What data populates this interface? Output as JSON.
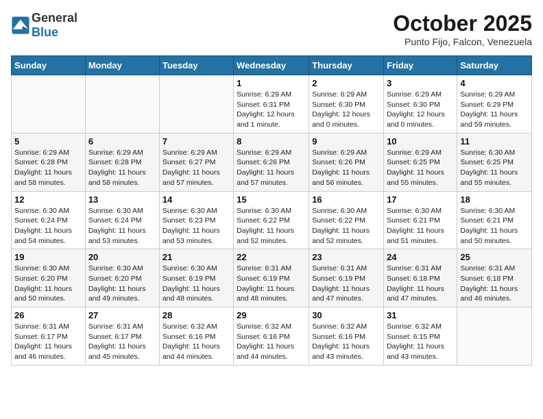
{
  "header": {
    "logo_general": "General",
    "logo_blue": "Blue",
    "month_title": "October 2025",
    "location": "Punto Fijo, Falcon, Venezuela"
  },
  "weekdays": [
    "Sunday",
    "Monday",
    "Tuesday",
    "Wednesday",
    "Thursday",
    "Friday",
    "Saturday"
  ],
  "weeks": [
    [
      {
        "day": "",
        "info": ""
      },
      {
        "day": "",
        "info": ""
      },
      {
        "day": "",
        "info": ""
      },
      {
        "day": "1",
        "info": "Sunrise: 6:29 AM\nSunset: 6:31 PM\nDaylight: 12 hours\nand 1 minute."
      },
      {
        "day": "2",
        "info": "Sunrise: 6:29 AM\nSunset: 6:30 PM\nDaylight: 12 hours\nand 0 minutes."
      },
      {
        "day": "3",
        "info": "Sunrise: 6:29 AM\nSunset: 6:30 PM\nDaylight: 12 hours\nand 0 minutes."
      },
      {
        "day": "4",
        "info": "Sunrise: 6:29 AM\nSunset: 6:29 PM\nDaylight: 11 hours\nand 59 minutes."
      }
    ],
    [
      {
        "day": "5",
        "info": "Sunrise: 6:29 AM\nSunset: 6:28 PM\nDaylight: 11 hours\nand 58 minutes."
      },
      {
        "day": "6",
        "info": "Sunrise: 6:29 AM\nSunset: 6:28 PM\nDaylight: 11 hours\nand 58 minutes."
      },
      {
        "day": "7",
        "info": "Sunrise: 6:29 AM\nSunset: 6:27 PM\nDaylight: 11 hours\nand 57 minutes."
      },
      {
        "day": "8",
        "info": "Sunrise: 6:29 AM\nSunset: 6:26 PM\nDaylight: 11 hours\nand 57 minutes."
      },
      {
        "day": "9",
        "info": "Sunrise: 6:29 AM\nSunset: 6:26 PM\nDaylight: 11 hours\nand 56 minutes."
      },
      {
        "day": "10",
        "info": "Sunrise: 6:29 AM\nSunset: 6:25 PM\nDaylight: 11 hours\nand 55 minutes."
      },
      {
        "day": "11",
        "info": "Sunrise: 6:30 AM\nSunset: 6:25 PM\nDaylight: 11 hours\nand 55 minutes."
      }
    ],
    [
      {
        "day": "12",
        "info": "Sunrise: 6:30 AM\nSunset: 6:24 PM\nDaylight: 11 hours\nand 54 minutes."
      },
      {
        "day": "13",
        "info": "Sunrise: 6:30 AM\nSunset: 6:24 PM\nDaylight: 11 hours\nand 53 minutes."
      },
      {
        "day": "14",
        "info": "Sunrise: 6:30 AM\nSunset: 6:23 PM\nDaylight: 11 hours\nand 53 minutes."
      },
      {
        "day": "15",
        "info": "Sunrise: 6:30 AM\nSunset: 6:22 PM\nDaylight: 11 hours\nand 52 minutes."
      },
      {
        "day": "16",
        "info": "Sunrise: 6:30 AM\nSunset: 6:22 PM\nDaylight: 11 hours\nand 52 minutes."
      },
      {
        "day": "17",
        "info": "Sunrise: 6:30 AM\nSunset: 6:21 PM\nDaylight: 11 hours\nand 51 minutes."
      },
      {
        "day": "18",
        "info": "Sunrise: 6:30 AM\nSunset: 6:21 PM\nDaylight: 11 hours\nand 50 minutes."
      }
    ],
    [
      {
        "day": "19",
        "info": "Sunrise: 6:30 AM\nSunset: 6:20 PM\nDaylight: 11 hours\nand 50 minutes."
      },
      {
        "day": "20",
        "info": "Sunrise: 6:30 AM\nSunset: 6:20 PM\nDaylight: 11 hours\nand 49 minutes."
      },
      {
        "day": "21",
        "info": "Sunrise: 6:30 AM\nSunset: 6:19 PM\nDaylight: 11 hours\nand 48 minutes."
      },
      {
        "day": "22",
        "info": "Sunrise: 6:31 AM\nSunset: 6:19 PM\nDaylight: 11 hours\nand 48 minutes."
      },
      {
        "day": "23",
        "info": "Sunrise: 6:31 AM\nSunset: 6:19 PM\nDaylight: 11 hours\nand 47 minutes."
      },
      {
        "day": "24",
        "info": "Sunrise: 6:31 AM\nSunset: 6:18 PM\nDaylight: 11 hours\nand 47 minutes."
      },
      {
        "day": "25",
        "info": "Sunrise: 6:31 AM\nSunset: 6:18 PM\nDaylight: 11 hours\nand 46 minutes."
      }
    ],
    [
      {
        "day": "26",
        "info": "Sunrise: 6:31 AM\nSunset: 6:17 PM\nDaylight: 11 hours\nand 46 minutes."
      },
      {
        "day": "27",
        "info": "Sunrise: 6:31 AM\nSunset: 6:17 PM\nDaylight: 11 hours\nand 45 minutes."
      },
      {
        "day": "28",
        "info": "Sunrise: 6:32 AM\nSunset: 6:16 PM\nDaylight: 11 hours\nand 44 minutes."
      },
      {
        "day": "29",
        "info": "Sunrise: 6:32 AM\nSunset: 6:16 PM\nDaylight: 11 hours\nand 44 minutes."
      },
      {
        "day": "30",
        "info": "Sunrise: 6:32 AM\nSunset: 6:16 PM\nDaylight: 11 hours\nand 43 minutes."
      },
      {
        "day": "31",
        "info": "Sunrise: 6:32 AM\nSunset: 6:15 PM\nDaylight: 11 hours\nand 43 minutes."
      },
      {
        "day": "",
        "info": ""
      }
    ]
  ]
}
